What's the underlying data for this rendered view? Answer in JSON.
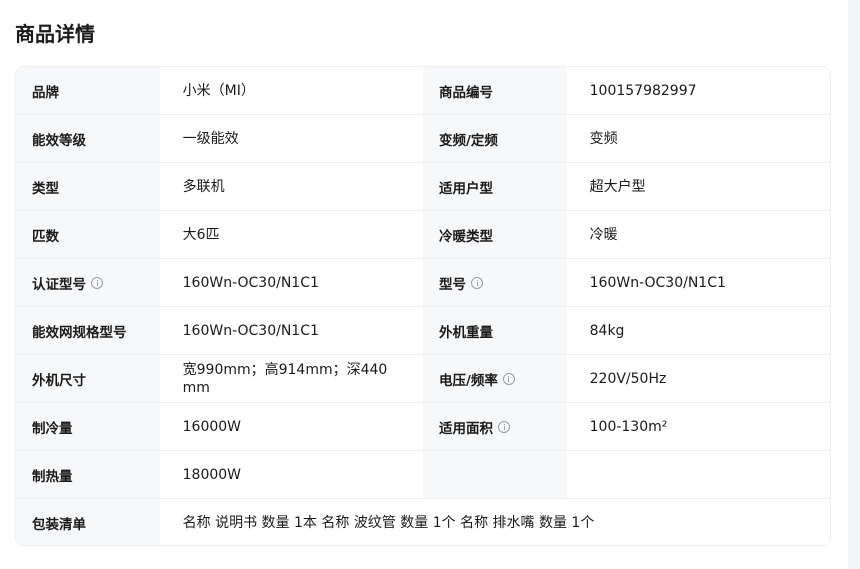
{
  "section_title": "商品详情",
  "rows": [
    {
      "l1": "品牌",
      "v1": "小米（MI）",
      "l2": "商品编号",
      "v2": "100157982997"
    },
    {
      "l1": "能效等级",
      "v1": "一级能效",
      "l2": "变频/定频",
      "v2": "变频"
    },
    {
      "l1": "类型",
      "v1": "多联机",
      "l2": "适用户型",
      "v2": "超大户型"
    },
    {
      "l1": "匹数",
      "v1": "大6匹",
      "l2": "冷暖类型",
      "v2": "冷暖"
    },
    {
      "l1": "认证型号",
      "v1": "160Wn-OC30/N1C1",
      "l2": "型号",
      "v2": "160Wn-OC30/N1C1"
    },
    {
      "l1": "能效网规格型号",
      "v1": "160Wn-OC30/N1C1",
      "l2": "外机重量",
      "v2": "84kg"
    },
    {
      "l1": "外机尺寸",
      "v1": "宽990mm；高914mm；深440mm",
      "l2": "电压/频率",
      "v2": "220V/50Hz"
    },
    {
      "l1": "制冷量",
      "v1": "16000W",
      "l2": "适用面积",
      "v2": "100-130m²"
    },
    {
      "l1": "制热量",
      "v1": "18000W",
      "l2": "",
      "v2": ""
    },
    {
      "l1": "包装清单",
      "v1": "名称 说明书 数量 1本 名称 波纹管 数量 1个 名称 排水嘴 数量 1个"
    }
  ]
}
